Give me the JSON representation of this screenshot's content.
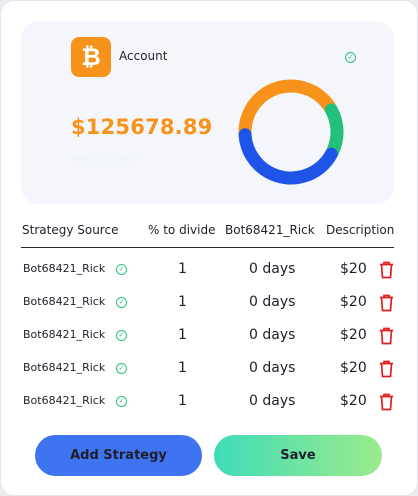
{
  "account": {
    "coin_symbol": "₿",
    "label": "Account",
    "balance": "$125678.89",
    "balance_sub": "Main balance",
    "check_glyph": "✓"
  },
  "donut": {
    "segments": [
      {
        "color": "#f7931a",
        "fraction": 0.42
      },
      {
        "color": "#22c07a",
        "fraction": 0.16
      },
      {
        "color": "#1f54e8",
        "fraction": 0.42
      }
    ]
  },
  "colors": {
    "accent_orange": "#f7931a",
    "accent_blue": "#3f74f0",
    "delete_red": "#e11d1d",
    "check_green": "#2cc37a"
  },
  "table": {
    "headers": [
      "Strategy Source",
      "% to divide",
      "Bot68421_Rick",
      "Description"
    ],
    "rows": [
      {
        "source": "Bot68421_Rick",
        "pct": "1",
        "days": "0 days",
        "price": "$20"
      },
      {
        "source": "Bot68421_Rick",
        "pct": "1",
        "days": "0 days",
        "price": "$20"
      },
      {
        "source": "Bot68421_Rick",
        "pct": "1",
        "days": "0 days",
        "price": "$20"
      },
      {
        "source": "Bot68421_Rick",
        "pct": "1",
        "days": "0 days",
        "price": "$20"
      },
      {
        "source": "Bot68421_Rick",
        "pct": "1",
        "days": "0 days",
        "price": "$20"
      }
    ]
  },
  "buttons": {
    "add_strategy": "Add Strategy",
    "save": "Save"
  },
  "icons": {
    "coin": "bitcoin-icon",
    "check": "check-circle-icon",
    "delete": "trash-icon"
  }
}
